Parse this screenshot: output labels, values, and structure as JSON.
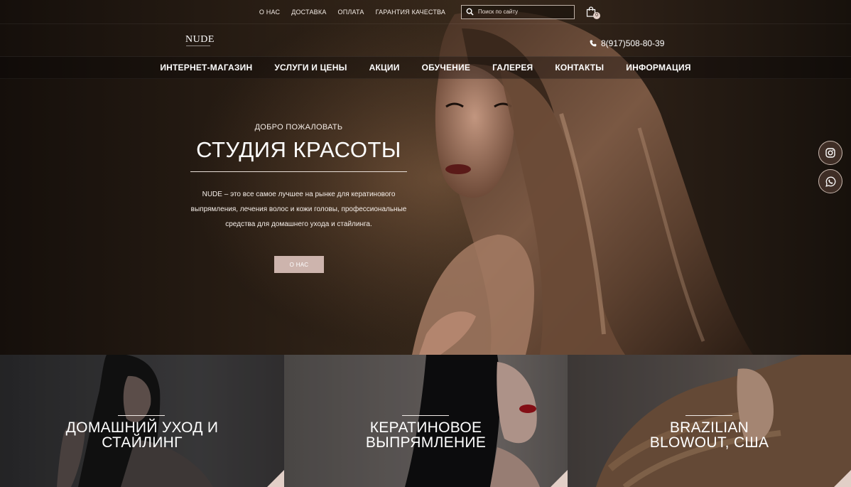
{
  "topbar": {
    "links": [
      "О НАС",
      "ДОСТАВКА",
      "ОПЛАТА",
      "ГАРАНТИЯ КАЧЕСТВА"
    ],
    "search_placeholder": "Поиск по сайту",
    "cart_count": "0"
  },
  "header": {
    "logo": "NUDE",
    "phone": "8(917)508-80-39"
  },
  "nav": [
    "ИНТЕРНЕТ-МАГАЗИН",
    "УСЛУГИ И ЦЕНЫ",
    "АКЦИИ",
    "ОБУЧЕНИЕ",
    "ГАЛЕРЕЯ",
    "КОНТАКТЫ",
    "ИНФОРМАЦИЯ"
  ],
  "hero": {
    "welcome": "ДОБРО ПОЖАЛОВАТЬ",
    "title": "СТУДИЯ КРАСОТЫ",
    "description": "NUDE – это все самое лучшее на рынке для кератинового выпрямления, лечения волос и кожи головы, профессиональные средства для домашнего ухода и стайлинга.",
    "button": "О НАС"
  },
  "social": [
    "instagram-icon",
    "whatsapp-icon"
  ],
  "colors": {
    "accent": "#cdb4ad",
    "corner": "#e2cfc7",
    "background": "#1f1610"
  },
  "tiles": [
    {
      "title_line1": "ДОМАШНИЙ УХОД И",
      "title_line2": "СТАЙЛИНГ"
    },
    {
      "title_line1": "КЕРАТИНОВОЕ",
      "title_line2": "ВЫПРЯМЛЕНИЕ"
    },
    {
      "title_line1": "BRAZILIAN",
      "title_line2": "BLOWOUT, США"
    }
  ]
}
